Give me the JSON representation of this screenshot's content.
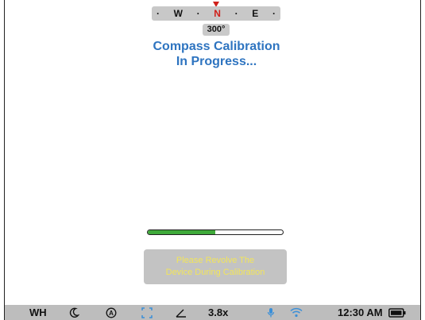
{
  "compass": {
    "west": "W",
    "north": "N",
    "east": "E",
    "dot": "·",
    "heading": "300°"
  },
  "calibration": {
    "title_line1": "Compass Calibration",
    "title_line2": "In Progress...",
    "progress_fraction": 0.5,
    "message_line1": "Please Revolve The",
    "message_line2": "Device During Calibration"
  },
  "status_bar": {
    "white_balance": "WH",
    "zoom": "3.8x",
    "time": "12:30 AM",
    "icons": [
      "night-mode-icon",
      "auto-mode-icon",
      "focus-frame-icon",
      "angle-icon",
      "microphone-icon",
      "wifi-icon",
      "battery-icon"
    ]
  },
  "colors": {
    "title": "#2e74c0",
    "north": "#d0211b",
    "progress": "#3faa3a",
    "message_text": "#f2e55a",
    "accent_icon": "#3a8fd8"
  }
}
